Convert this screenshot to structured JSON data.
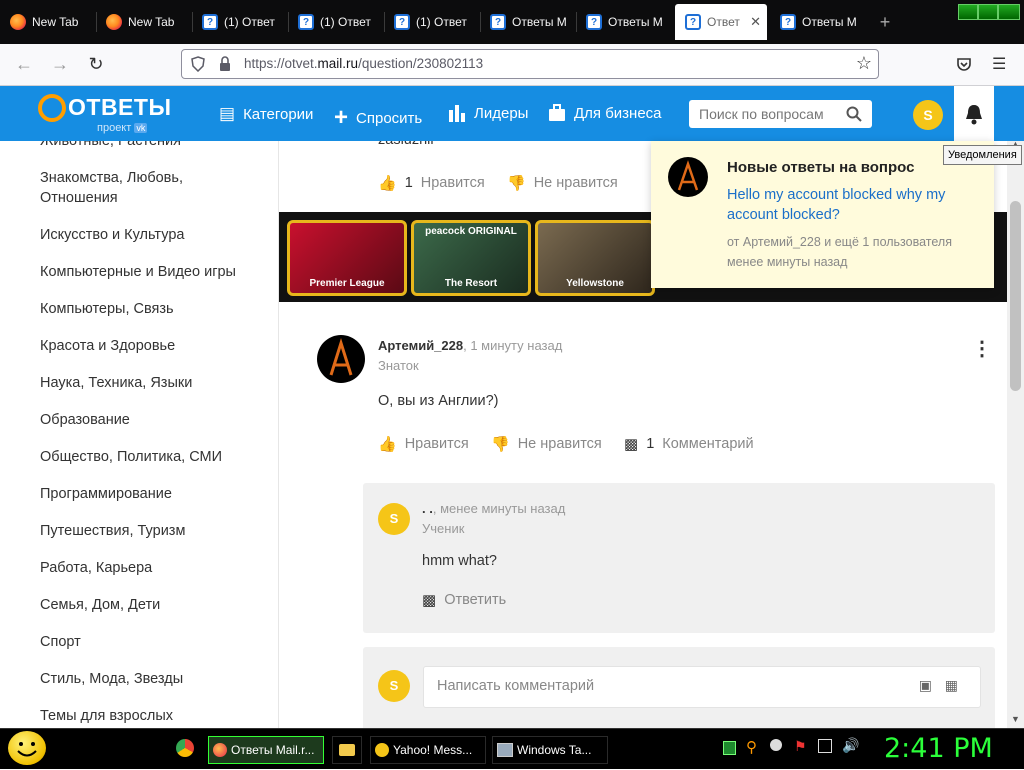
{
  "browser": {
    "tabs": [
      {
        "title": "New Tab",
        "icon": "firefox-icon",
        "active": false
      },
      {
        "title": "New Tab",
        "icon": "firefox-icon",
        "active": false
      },
      {
        "title": "(1) Ответ",
        "icon": "question-icon",
        "active": false
      },
      {
        "title": "(1) Ответ",
        "icon": "question-icon",
        "active": false
      },
      {
        "title": "(1) Ответ",
        "icon": "question-icon",
        "active": false
      },
      {
        "title": "Ответы M",
        "icon": "question-icon",
        "active": false
      },
      {
        "title": "Ответы M",
        "icon": "question-icon",
        "active": false
      },
      {
        "title": "Ответ",
        "icon": "question-icon",
        "active": true
      },
      {
        "title": "Ответы M",
        "icon": "question-icon",
        "active": false
      }
    ],
    "new_tab_glyph": "+",
    "close_glyph": "✕",
    "url_prefix": "https://otvet.",
    "url_domain": "mail.ru",
    "url_path": "/question/230802113"
  },
  "site": {
    "logo_text": "ОТВЕТЫ",
    "logo_sub": "проект",
    "nav": {
      "categories": "Категории",
      "ask": "Спросить",
      "leaders": "Лидеры",
      "business": "Для бизнеса"
    },
    "search_placeholder": "Поиск по вопросам",
    "avatar_letter": "S"
  },
  "sidebar": {
    "partial_top": "Животные, Растения",
    "items": [
      "Знакомства, Любовь, Отношения",
      "Искусство и Культура",
      "Компьютерные и Видео игры",
      "Компьютеры, Связь",
      "Красота и Здоровье",
      "Наука, Техника, Языки",
      "Образование",
      "Общество, Политика, СМИ",
      "Программирование",
      "Путешествия, Туризм",
      "Работа, Карьера",
      "Семья, Дом, Дети",
      "Спорт",
      "Стиль, Мода, Звезды",
      "Темы для взрослых"
    ]
  },
  "main": {
    "prev_answer": {
      "text_partial": "zasluzhil",
      "likes": "1",
      "like_label": "Нравится",
      "dislike_label": "Не нравится"
    },
    "ads": [
      "Premier League",
      "The Resort",
      "Yellowstone"
    ],
    "ad_brand": "peacock ORIGINAL",
    "answer": {
      "author": "Артемий_228",
      "time": ", 1 минуту назад",
      "rank": "Знаток",
      "text": "О, вы из Англии?)",
      "like_label": "Нравится",
      "dislike_label": "Не нравится",
      "comment_count": "1",
      "comment_label": "Комментарий",
      "more_glyph": "⋮"
    },
    "comment": {
      "avatar_letter": "S",
      "author": ". .",
      "time": ", менее минуты назад",
      "rank": "Ученик",
      "text": "hmm what?",
      "reply_label": "Ответить"
    },
    "compose": {
      "avatar_letter": "S",
      "placeholder": "Написать комментарий"
    }
  },
  "notification": {
    "title": "Новые ответы на вопрос",
    "question": "Hello my account blocked why my account blocked?",
    "from": "от Артемий_228 и ещё 1 пользователя",
    "time": "менее минуты назад",
    "tooltip": "Уведомления"
  },
  "taskbar": {
    "buttons": [
      {
        "label": "Ответы Mail.r...",
        "active": true
      },
      {
        "label": "",
        "active": false
      },
      {
        "label": "Yahoo! Mess...",
        "active": false
      },
      {
        "label": "Windows Ta...",
        "active": false
      }
    ],
    "clock": "2:41 PM"
  },
  "colors": {
    "brand_blue": "#168de2",
    "logo_orange": "#ff9e00",
    "avatar_yellow": "#f5c518",
    "link_blue": "#1a6fc9",
    "clock_green": "#2bff3a",
    "notif_bg": "#fffbdc"
  }
}
